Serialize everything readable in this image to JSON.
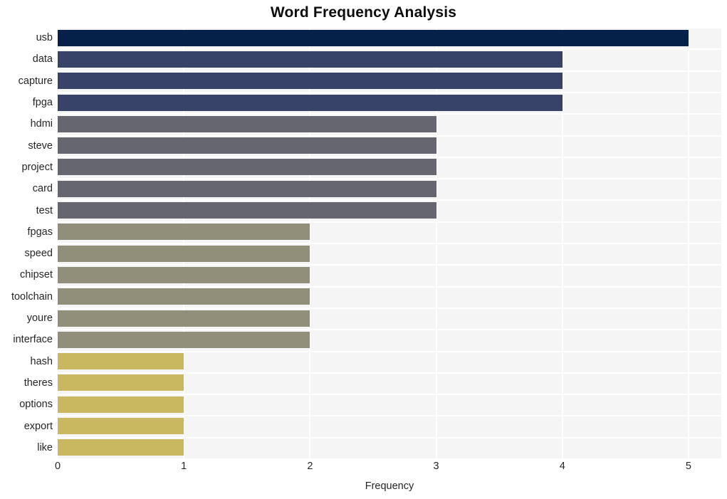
{
  "chart_data": {
    "type": "bar",
    "orientation": "horizontal",
    "title": "Word Frequency Analysis",
    "xlabel": "Frequency",
    "ylabel": "",
    "categories": [
      "usb",
      "data",
      "capture",
      "fpga",
      "hdmi",
      "steve",
      "project",
      "card",
      "test",
      "fpgas",
      "speed",
      "chipset",
      "toolchain",
      "youre",
      "interface",
      "hash",
      "theres",
      "options",
      "export",
      "like"
    ],
    "values": [
      5,
      4,
      4,
      4,
      3,
      3,
      3,
      3,
      3,
      2,
      2,
      2,
      2,
      2,
      2,
      1,
      1,
      1,
      1,
      1
    ],
    "bar_colors": [
      "#052049",
      "#374369",
      "#374369",
      "#374369",
      "#65666f",
      "#65666f",
      "#65666f",
      "#65666f",
      "#65666f",
      "#918e79",
      "#918e79",
      "#918e79",
      "#918e79",
      "#918e79",
      "#918e79",
      "#c9b860",
      "#c9b860",
      "#c9b860",
      "#c9b860",
      "#c9b860"
    ],
    "xlim": [
      0,
      5.26
    ],
    "x_ticks": [
      0,
      1,
      2,
      3,
      4,
      5
    ],
    "x_tick_labels": [
      "0",
      "1",
      "2",
      "3",
      "4",
      "5"
    ],
    "grid": true,
    "grid_color": "#ffffff",
    "plot_background": "#f5f5f6",
    "figure_background": "#ffffff",
    "legend": null
  }
}
